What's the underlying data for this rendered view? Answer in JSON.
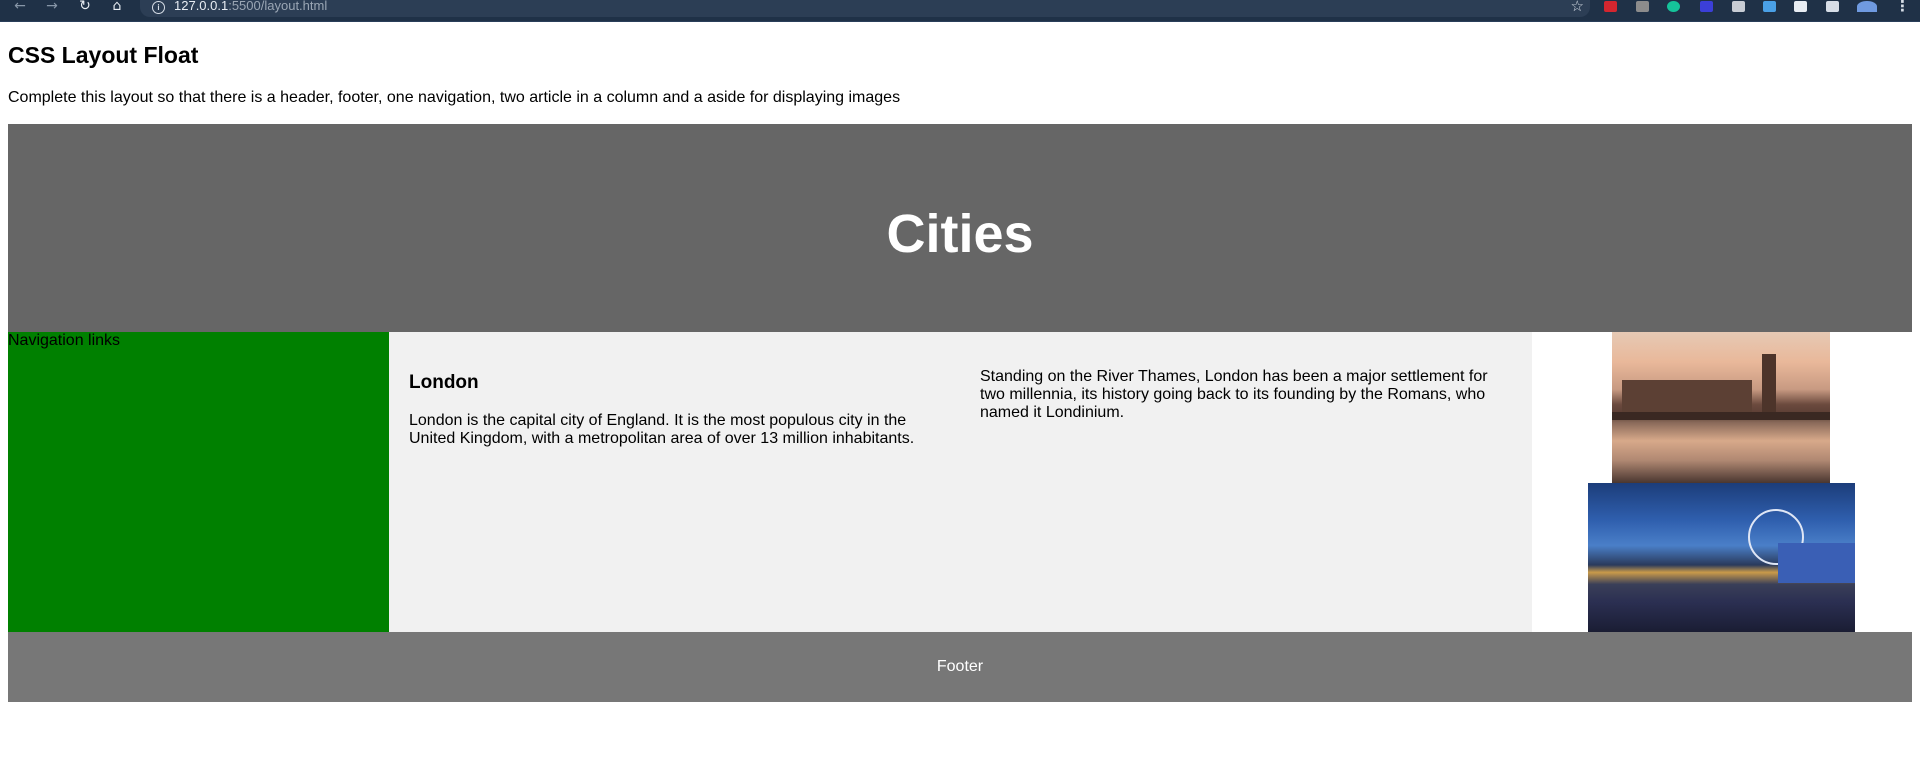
{
  "browser": {
    "back_icon": "←",
    "forward_icon": "→",
    "reload_icon": "↻",
    "home_icon": "⌂",
    "url_host": "127.0.0.1",
    "url_rest": ":5500/layout.html",
    "star_icon": "☆",
    "menu_icon": "⋮"
  },
  "page": {
    "title": "CSS Layout Float",
    "description": "Complete this layout so that there is a header, footer, one navigation, two article in a column and a aside for displaying images"
  },
  "header": {
    "heading": "Cities"
  },
  "nav": {
    "label": "Navigation links"
  },
  "articles": [
    {
      "heading": "London",
      "text": "London is the capital city of England. It is the most populous city in the United Kingdom, with a metropolitan area of over 13 million inhabitants."
    },
    {
      "text": "Standing on the River Thames, London has been a major settlement for two millennia, its history going back to its founding by the Romans, who named it Londinium."
    }
  ],
  "footer": {
    "label": "Footer"
  },
  "colors": {
    "header_bg": "#666666",
    "nav_bg": "#008000",
    "articles_bg": "#f1f1f1",
    "footer_bg": "#777777",
    "browser_bg": "#1f3147"
  }
}
